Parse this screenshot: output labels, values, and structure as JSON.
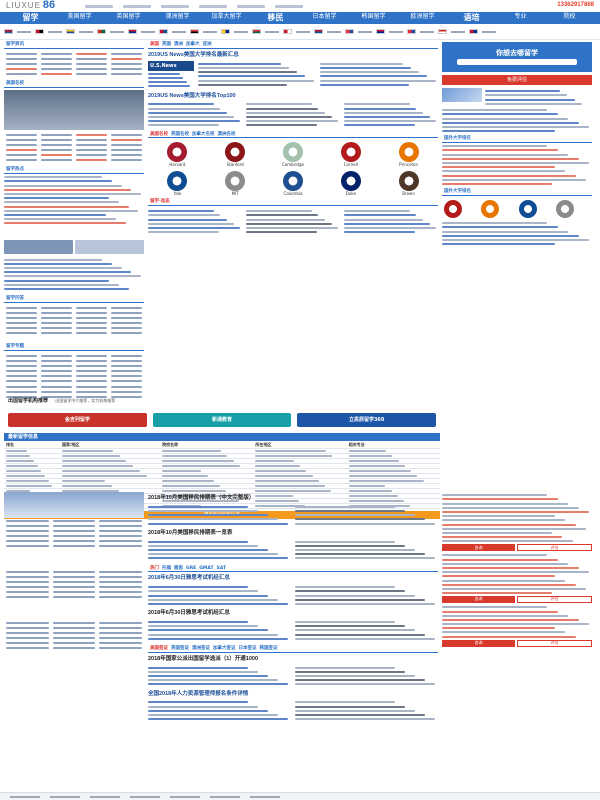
{
  "logo": {
    "text": "LIUXUE",
    "num": "86"
  },
  "phone": "13362917868",
  "nav": [
    "留学",
    "美国留学",
    "英国留学",
    "澳洲留学",
    "加拿大留学",
    "移民",
    "日本留学",
    "韩国留学",
    "欧洲留学",
    "语培",
    "专业",
    "院校"
  ],
  "nav_strong_indexes": [
    0,
    5,
    9
  ],
  "left": {
    "box1_title": "留学资讯",
    "box2_title": "美国名校",
    "box3_title": "留学热点",
    "box4_title": "留学问答",
    "box5_title": "留学专题"
  },
  "mid": {
    "tabs": [
      "美国",
      "英国",
      "澳洲",
      "加拿大",
      "亚洲"
    ],
    "headline1": "2019US News美国大学排名最新汇总",
    "usnews_badge": "U.S.News",
    "headline2": "2019US News美国大学排名Top100",
    "uni_tabs": [
      "美国名校",
      "英国名校",
      "加拿大名校",
      "澳洲名校"
    ],
    "uni_names": [
      "Harvard",
      "Stanford",
      "Cambridge",
      "Cornell",
      "Princeton",
      "Yale",
      "MIT",
      "Columbia",
      "Duke",
      "Brown"
    ],
    "news_head": "留学·动态",
    "agency_label": "出国留学机构推荐",
    "agency_sub": "·出国留学中介推荐，实力机构推荐",
    "agency_logos": [
      "金吉列留学",
      "新通教育",
      "立思辰留学360"
    ],
    "table_head": "最新留学信息",
    "table_cols": [
      "排名",
      "国家/地区",
      "院校名称",
      "所在地区",
      "相关专业"
    ],
    "orange_bar": "更多留学院校信息",
    "headline3": "2018年10月美国移民排期表（中文完整版）",
    "headline4": "2018年10月美国移民排期表一览表",
    "tabs2": [
      "热门",
      "托福",
      "雅思",
      "GRE",
      "GMAT",
      "SAT"
    ],
    "headline5": "2018年6月30日雅思考试机经汇总",
    "headline6": "2018年6月30日雅思考试机经汇总",
    "tabs3": [
      "美国签证",
      "英国签证",
      "澳洲签证",
      "加拿大签证",
      "日本签证",
      "韩国签证"
    ],
    "headline7": "2018年国家公派出国留学选派（1）开通1000",
    "headline8": "全国2018年人力资源管理师报名条件详情"
  },
  "right": {
    "ad_title": "你想去哪留学",
    "ad_button": "免费评估",
    "rank_title": "国外大学排名",
    "rank_title2": "国外大学排名",
    "btn_a": "咨询",
    "btn_b": "评估"
  },
  "colors": {
    "brand": "#2e73c7",
    "accent": "#d9382c",
    "orange": "#f39a1e"
  }
}
